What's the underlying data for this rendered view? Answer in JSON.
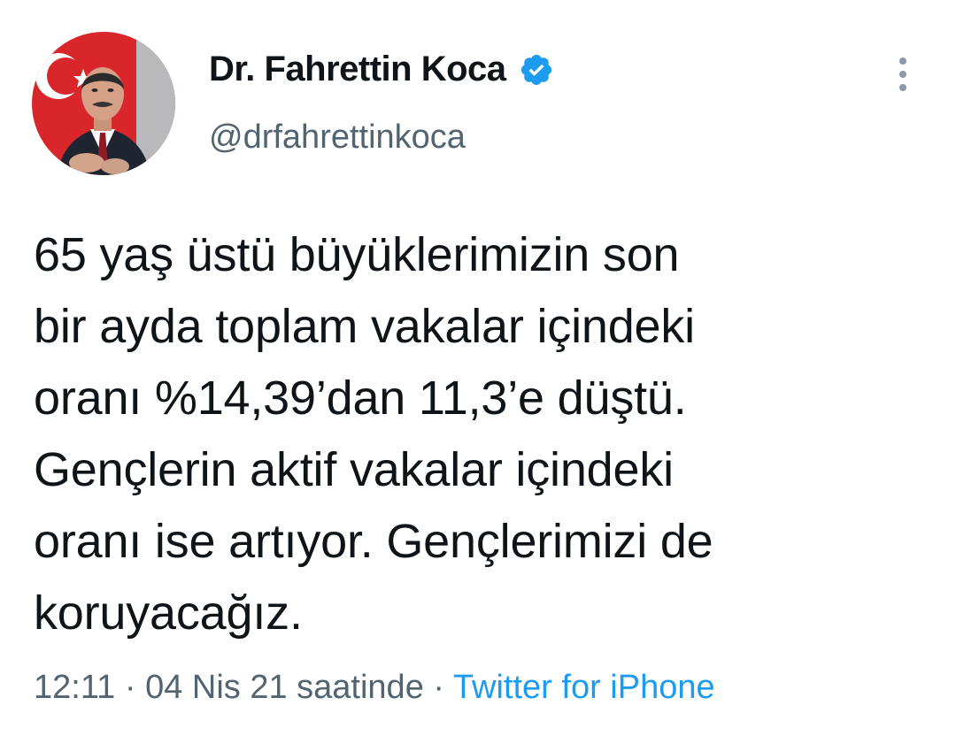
{
  "author": {
    "name": "Dr. Fahrettin Koca",
    "handle": "@drfahrettinkoca",
    "verified": true,
    "avatar_icon": "profile-photo-avatar"
  },
  "tweet": {
    "lines": [
      "65 yaş üstü büyüklerimizin son",
      "bir ayda toplam vakalar içindeki",
      "oranı %14,39’dan 11,3’e düştü.",
      "Gençlerin aktif vakalar içindeki",
      "oranı ise artıyor. Gençlerimizi de",
      "koruyacağız."
    ]
  },
  "meta": {
    "time": "12:11",
    "separator": "·",
    "date": "04 Nis 21 saatinde",
    "source": "Twitter for iPhone"
  },
  "icons": {
    "verified": "verified-badge-icon",
    "more": "more-vertical-icon"
  },
  "colors": {
    "accent": "#1d9bf0",
    "secondary_text": "#536471",
    "primary_text": "#0f1419"
  }
}
